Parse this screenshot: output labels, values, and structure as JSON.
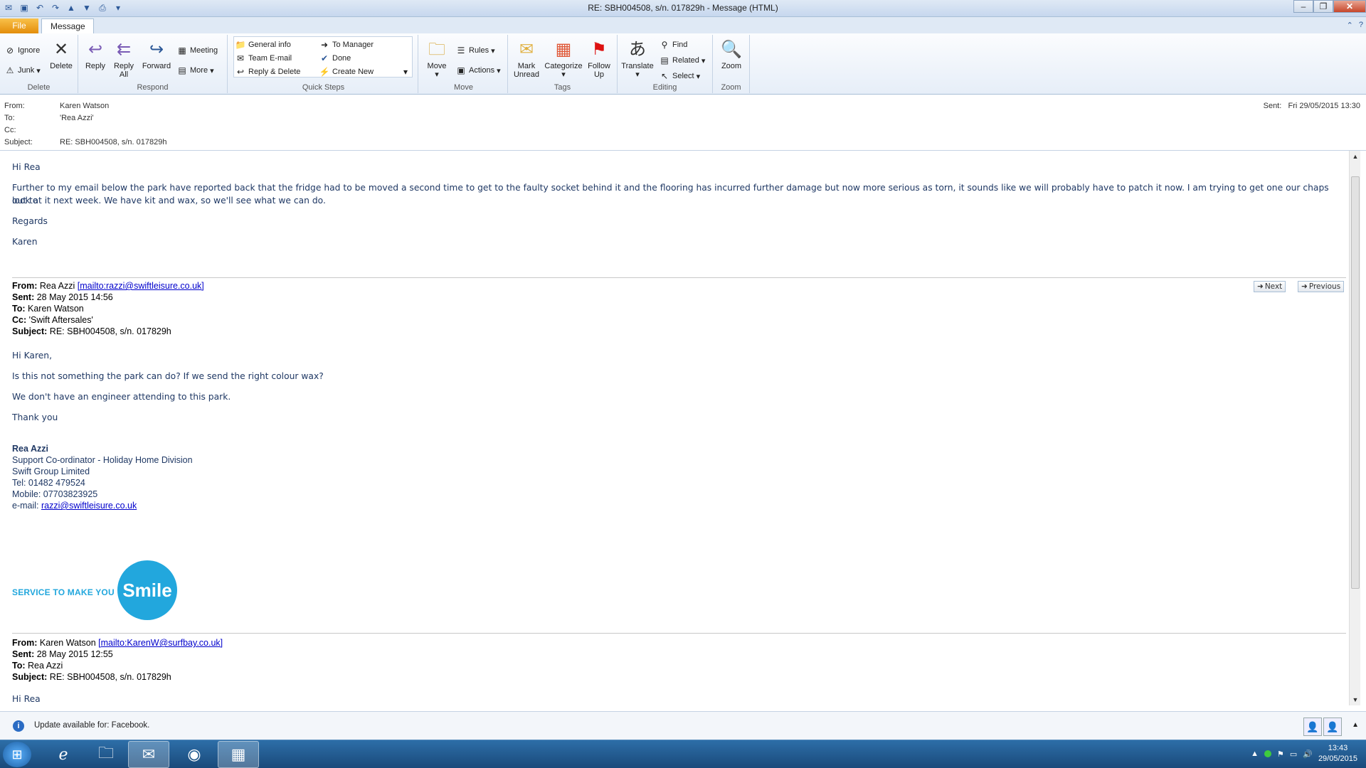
{
  "window": {
    "title": "RE: SBH004508, s/n. 017829h  -  Message (HTML)"
  },
  "tabs": {
    "file": "File",
    "message": "Message"
  },
  "ribbon": {
    "delete_group": {
      "label": "Delete",
      "ignore": "Ignore",
      "junk": "Junk",
      "delete": "Delete"
    },
    "respond_group": {
      "label": "Respond",
      "reply": "Reply",
      "reply_all_1": "Reply",
      "reply_all_2": "All",
      "forward": "Forward",
      "meeting": "Meeting",
      "more": "More"
    },
    "quicksteps_group": {
      "label": "Quick Steps",
      "general_info": "General info",
      "team_email": "Team E-mail",
      "reply_delete": "Reply & Delete",
      "to_manager": "To Manager",
      "done": "Done",
      "create_new": "Create New"
    },
    "move_group": {
      "label": "Move",
      "move": "Move",
      "rules": "Rules",
      "actions": "Actions"
    },
    "tags_group": {
      "label": "Tags",
      "mark_unread_1": "Mark",
      "mark_unread_2": "Unread",
      "categorize": "Categorize",
      "follow_up_1": "Follow",
      "follow_up_2": "Up"
    },
    "editing_group": {
      "label": "Editing",
      "translate": "Translate",
      "find": "Find",
      "related": "Related",
      "select": "Select"
    },
    "zoom_group": {
      "label": "Zoom",
      "zoom": "Zoom"
    }
  },
  "header": {
    "from_label": "From:",
    "from": "Karen Watson",
    "to_label": "To:",
    "to": "'Rea Azzi'",
    "cc_label": "Cc:",
    "cc": "",
    "subject_label": "Subject:",
    "subject": "RE: SBH004508, s/n. 017829h",
    "sent_label": "Sent:",
    "sent": "Fri 29/05/2015 13:30"
  },
  "message": {
    "greeting": "Hi Rea",
    "para1": "Further to my email below the park have reported back that the fridge had to be moved a second time to get to the faulty socket behind it and the flooring has incurred further damage but now more serious as torn, it sounds like we will probably have to patch it now. I am trying to get one our chaps out to",
    "para1b": "look at it next week. We have kit and wax, so we'll see what we can do.",
    "regards": "Regards",
    "name": "Karen"
  },
  "quoted1": {
    "from_label": "From:",
    "from": "Rea Azzi",
    "from_link": "[mailto:razzi@swiftleisure.co.uk]",
    "sent_label": "Sent:",
    "sent": "28 May 2015 14:56",
    "to_label": "To:",
    "to": "Karen Watson",
    "cc_label": "Cc:",
    "cc": "'Swift Aftersales'",
    "subject_label": "Subject:",
    "subject": "RE: SBH004508, s/n. 017829h",
    "greeting": "Hi Karen,",
    "line1": "Is this not something the park can do? If we send the right colour wax?",
    "line2": "We don't have an engineer attending to this park.",
    "thanks": "Thank you",
    "sig_name": "Rea Azzi",
    "sig_title": "Support Co-ordinator - Holiday Home Division",
    "sig_company": "Swift Group Limited",
    "sig_tel": "Tel: 01482 479524",
    "sig_mobile": "Mobile: 07703823925",
    "sig_email_label": "e-mail: ",
    "sig_email": "razzi@swiftleisure.co.uk",
    "logo_text": "SERVICE TO MAKE YOU",
    "logo_smile": "Smile"
  },
  "quoted2": {
    "from_label": "From:",
    "from": "Karen Watson",
    "from_link": "[mailto:KarenW@surfbay.co.uk]",
    "sent_label": "Sent:",
    "sent": "28 May 2015 12:55",
    "to_label": "To:",
    "to": "Rea Azzi",
    "subject_label": "Subject:",
    "subject": "RE: SBH004508, s/n. 017829h",
    "greeting": "Hi Rea"
  },
  "nav": {
    "next": "Next",
    "previous": "Previous"
  },
  "infobar": {
    "text": "Update available for: Facebook."
  },
  "taskbar": {
    "time": "13:43",
    "date": "29/05/2015"
  }
}
